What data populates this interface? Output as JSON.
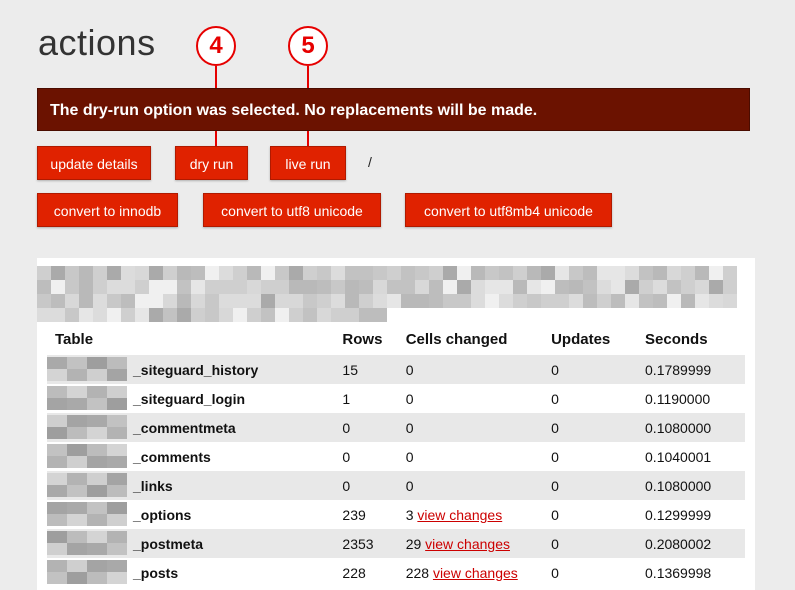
{
  "page": {
    "title": "actions"
  },
  "callouts": [
    {
      "label": "4"
    },
    {
      "label": "5"
    }
  ],
  "notice": {
    "text": "The dry-run option was selected. No replacements will be made."
  },
  "buttons": {
    "update_details": "update details",
    "dry_run": "dry run",
    "live_run": "live run",
    "separator": "/",
    "convert_innodb": "convert to innodb",
    "convert_utf8": "convert to utf8 unicode",
    "convert_utf8mb4": "convert to utf8mb4 unicode"
  },
  "table": {
    "headers": [
      "Table",
      "Rows",
      "Cells changed",
      "Updates",
      "Seconds"
    ],
    "rows": [
      {
        "name": "_siteguard_history",
        "rows": "15",
        "cells": "0",
        "link": "",
        "updates": "0",
        "seconds": "0.1789999"
      },
      {
        "name": "_siteguard_login",
        "rows": "1",
        "cells": "0",
        "link": "",
        "updates": "0",
        "seconds": "0.1190000"
      },
      {
        "name": "_commentmeta",
        "rows": "0",
        "cells": "0",
        "link": "",
        "updates": "0",
        "seconds": "0.1080000"
      },
      {
        "name": "_comments",
        "rows": "0",
        "cells": "0",
        "link": "",
        "updates": "0",
        "seconds": "0.1040001"
      },
      {
        "name": "_links",
        "rows": "0",
        "cells": "0",
        "link": "",
        "updates": "0",
        "seconds": "0.1080000"
      },
      {
        "name": "_options",
        "rows": "239",
        "cells": "3",
        "link": "view changes",
        "updates": "0",
        "seconds": "0.1299999"
      },
      {
        "name": "_postmeta",
        "rows": "2353",
        "cells": "29",
        "link": "view changes",
        "updates": "0",
        "seconds": "0.2080002"
      },
      {
        "name": "_posts",
        "rows": "228",
        "cells": "228",
        "link": "view changes",
        "updates": "0",
        "seconds": "0.1369998"
      }
    ]
  },
  "colors": {
    "button": "#e02200",
    "notice": "#6b1200",
    "callout": "#e60000",
    "link": "#cc0000"
  }
}
